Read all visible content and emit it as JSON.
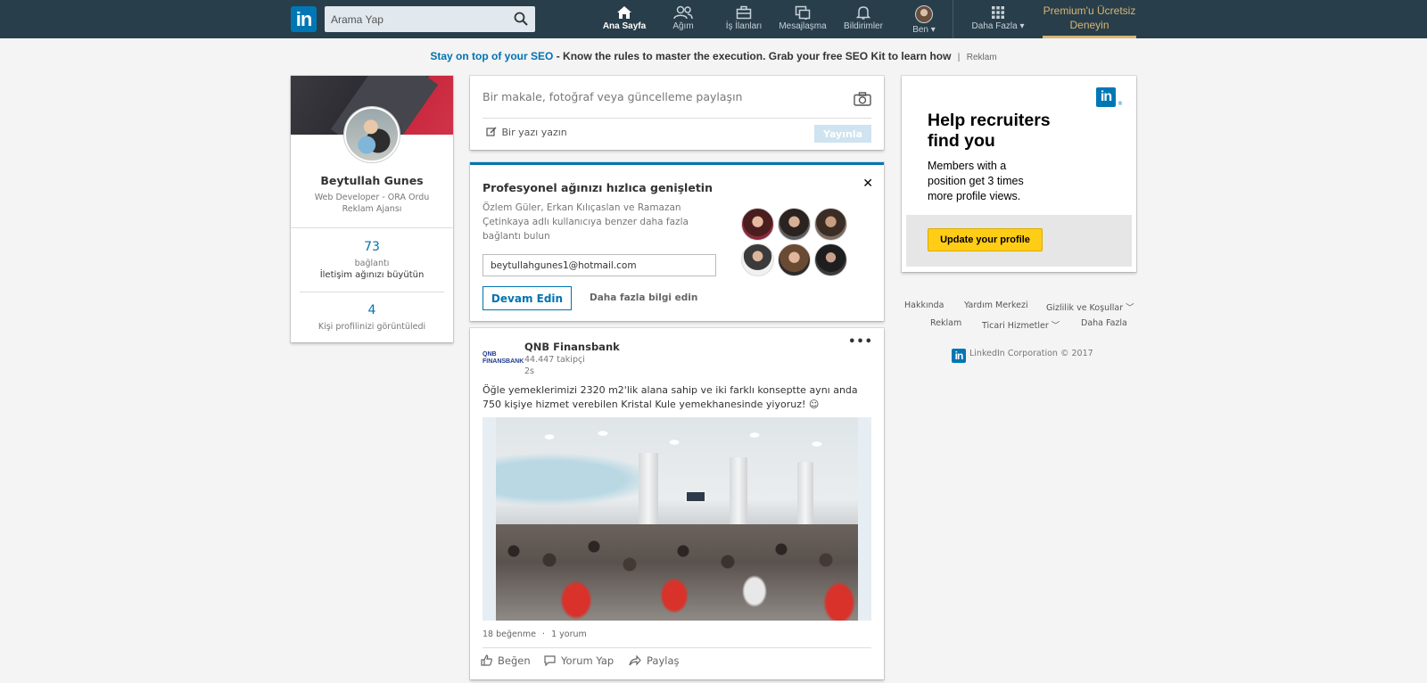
{
  "nav": {
    "logo": "in",
    "search_placeholder": "Arama Yap",
    "items": [
      {
        "label": "Ana Sayfa",
        "icon": "home-icon"
      },
      {
        "label": "Ağım",
        "icon": "network-icon"
      },
      {
        "label": "İş İlanları",
        "icon": "jobs-icon"
      },
      {
        "label": "Mesajlaşma",
        "icon": "messaging-icon"
      },
      {
        "label": "Bildirimler",
        "icon": "bell-icon"
      },
      {
        "label": "Ben ▾",
        "icon": "avatar"
      },
      {
        "label": "Daha Fazla ▾",
        "icon": "grid-icon"
      }
    ],
    "premium_line1": "Premium'u Ücretsiz",
    "premium_line2": "Deneyin"
  },
  "ad_line": {
    "highlight": "Stay on top of your SEO",
    "text": " - Know the rules to master the execution. Grab your free SEO Kit to learn how",
    "separator": "|",
    "tag": "Reklam"
  },
  "profile": {
    "name": "Beytullah Gunes",
    "title": "Web Developer - ORA Ordu Reklam Ajansı",
    "connections_count": "73",
    "connections_label": "bağlantı",
    "grow_link": "İletişim ağınızı büyütün",
    "views_count": "4",
    "views_label": "Kişi profilinizi görüntüledi"
  },
  "share": {
    "placeholder": "Bir makale, fotoğraf veya güncelleme paylaşın",
    "write_link": "Bir yazı yazın",
    "publish": "Yayınla"
  },
  "pymk": {
    "title": "Profesyonel ağınızı hızlıca genişletin",
    "close": "✕",
    "description": "Özlem Güler, Erkan Kılıçaslan ve Ramazan Çetinkaya adlı kullanıcıya benzer daha fazla bağlantı bulun",
    "email": "beytullahgunes1@hotmail.com",
    "continue": "Devam Edin",
    "learn_more": "Daha fazla bilgi edin"
  },
  "post": {
    "company_logo_text": "QNB FINANSBANK",
    "company": "QNB Finansbank",
    "followers": "44.447 takipçi",
    "time": "2s",
    "more": "•••",
    "text": "Öğle yemeklerimizi 2320 m2'lik alana sahip ve iki farklı konseptte aynı anda 750 kişiye hizmet verebilen Kristal Kule yemekhanesinde yiyoruz! ☺",
    "likes": "18 beğenme",
    "dot": "·",
    "comments": "1 yorum",
    "actions": {
      "like": "Beğen",
      "comment": "Yorum Yap",
      "share": "Paylaş"
    }
  },
  "ad_card": {
    "logo": "in",
    "reg": "®",
    "headline": "Help recruiters find you",
    "body": "Members with a position get 3 times more profile views.",
    "button": "Update your profile"
  },
  "footer": {
    "row1": [
      "Hakkında",
      "Yardım Merkezi",
      "Gizlilik ve Koşullar ﹀"
    ],
    "row2": [
      "Reklam",
      "Ticari Hizmetler ﹀",
      "Daha Fazla"
    ],
    "logo": "in",
    "copyright": "LinkedIn Corporation © 2017"
  },
  "colors": {
    "nav_bg": "#283e4a",
    "brand_blue": "#0077b5",
    "link_blue": "#0073b1",
    "premium_gold": "#d8b676",
    "ad_button": "#ffcd16"
  }
}
